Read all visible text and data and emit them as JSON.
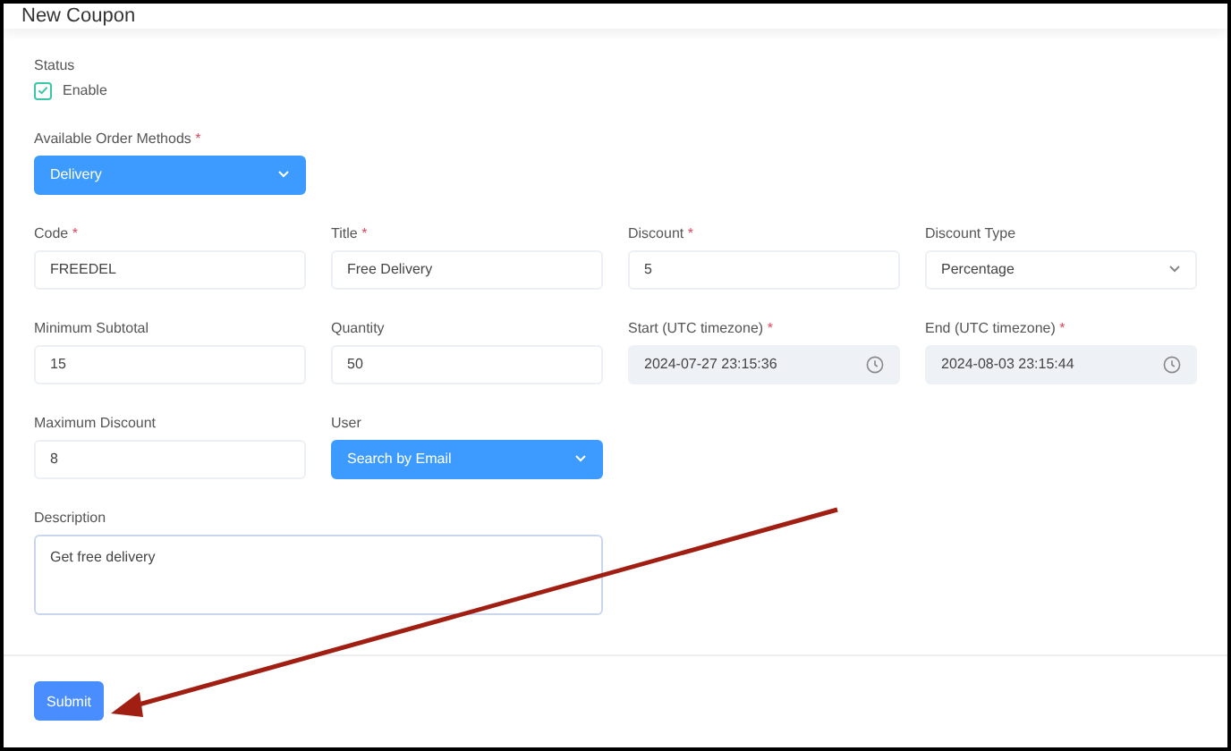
{
  "window": {
    "title": "New Coupon"
  },
  "status": {
    "label": "Status",
    "option": "Enable",
    "checked": true
  },
  "order_methods": {
    "label": "Available Order Methods",
    "mark": "*",
    "value": "Delivery",
    "highlighted": true
  },
  "fields": [
    {
      "kind": "text",
      "label": "Code",
      "mark": "*",
      "value": "FREEDEL"
    },
    {
      "kind": "text",
      "label": "Title",
      "mark": "*",
      "value": "Free Delivery"
    },
    {
      "kind": "text",
      "label": "Discount",
      "mark": "*",
      "value": "5"
    },
    {
      "kind": "select",
      "label": "Discount Type",
      "value": "Percentage",
      "highlighted": false
    },
    {
      "kind": "text",
      "label": "Minimum Subtotal",
      "value": "15"
    },
    {
      "kind": "text",
      "label": "Quantity",
      "value": "50"
    },
    {
      "kind": "datetime",
      "label": "Start (UTC timezone)",
      "mark": "*",
      "value": "2024-07-27 23:15:36"
    },
    {
      "kind": "datetime",
      "label": "End (UTC timezone)",
      "mark": "*",
      "value": "2024-08-03 23:15:44"
    },
    {
      "kind": "text",
      "label": "Maximum Discount",
      "value": "8"
    },
    {
      "kind": "select",
      "label": "User",
      "value": "Search by Email",
      "highlighted": true
    }
  ],
  "description": {
    "label": "Description",
    "value": "Get free delivery"
  },
  "submit": {
    "label": "Submit"
  }
}
